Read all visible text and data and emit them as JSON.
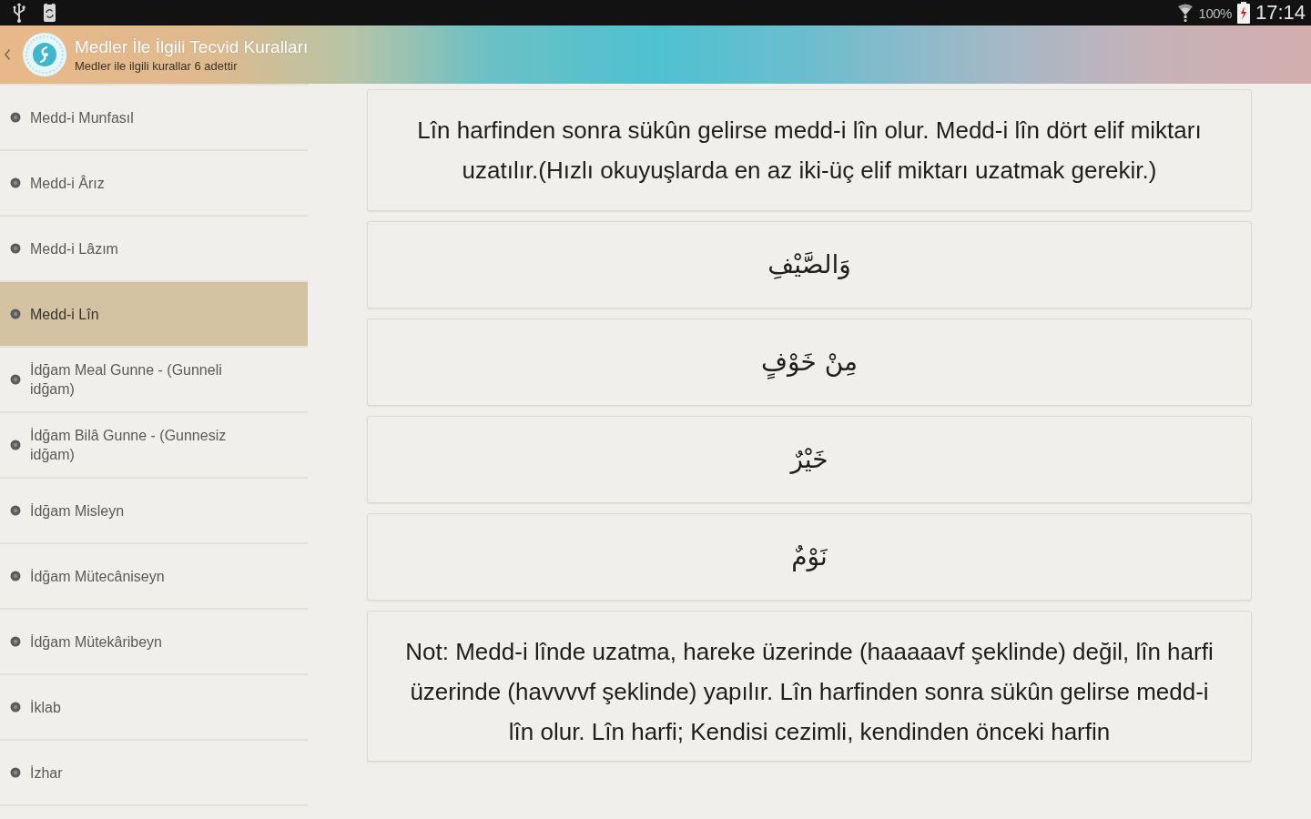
{
  "status_bar": {
    "battery": "100%",
    "time": "17:14"
  },
  "header": {
    "title": "Medler İle İlgili Tecvid Kuralları",
    "subtitle": "Medler ile ilgili kurallar 6 adettir"
  },
  "sidebar": {
    "items": [
      {
        "label": "Medd-i Munfasıl",
        "selected": false
      },
      {
        "label": "Medd-i Ârız",
        "selected": false
      },
      {
        "label": "Medd-i Lâzım",
        "selected": false
      },
      {
        "label": "Medd-i Lîn",
        "selected": true
      },
      {
        "label": "İdğam Meal Gunne - (Gunneli idğam)",
        "selected": false
      },
      {
        "label": "İdğam Bilâ Gunne - (Gunnesiz idğam)",
        "selected": false
      },
      {
        "label": "İdğam Misleyn",
        "selected": false
      },
      {
        "label": "İdğam Mütecâniseyn",
        "selected": false
      },
      {
        "label": "İdğam Mütekâribeyn",
        "selected": false
      },
      {
        "label": "İklab",
        "selected": false
      },
      {
        "label": "İzhar",
        "selected": false
      }
    ]
  },
  "content": {
    "cards": [
      {
        "kind": "text",
        "text": "Lîn harfinden sonra sükûn gelirse medd-i lîn olur. Medd-i lîn dört elif miktarı uzatılır.(Hızlı okuyuşlarda en az iki-üç elif miktarı uzatmak gerekir.)"
      },
      {
        "kind": "arabic",
        "text": "وَالصَّيْفِ"
      },
      {
        "kind": "arabic",
        "text": "مِنْ خَوْفٍ"
      },
      {
        "kind": "arabic",
        "text": "خَيْرٌ"
      },
      {
        "kind": "arabic",
        "text": "نَوْمٌ"
      },
      {
        "kind": "text",
        "text": "Not: Medd-i lînde uzatma, hareke üzerinde (haaaaavf şeklinde) değil, lîn harfi üzerinde (havvvvf şeklinde) yapılır. Lîn harfinden sonra sükûn gelirse medd-i lîn olur. Lîn harfi; Kendisi cezimli, kendinden önceki harfin"
      }
    ]
  }
}
